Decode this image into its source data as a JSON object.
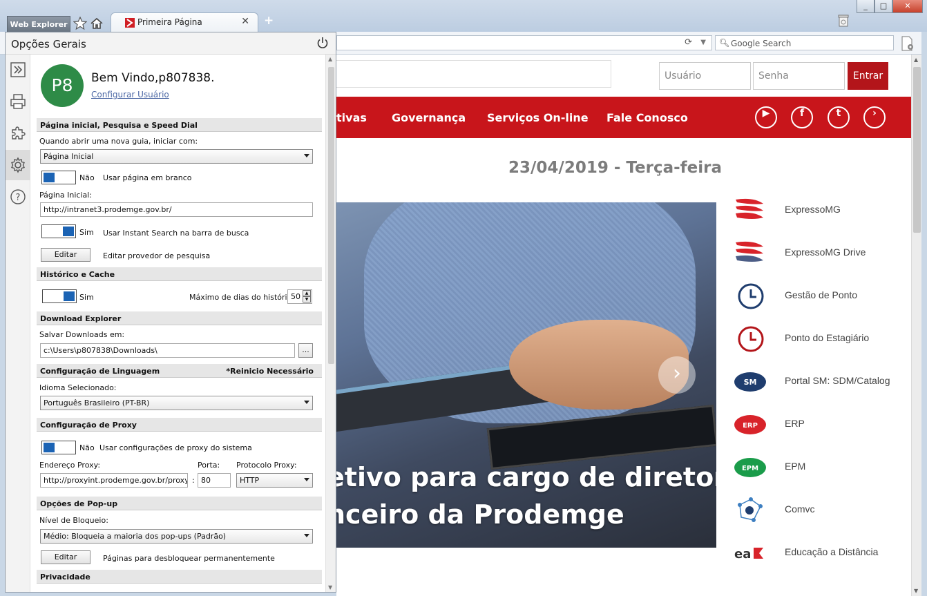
{
  "browser": {
    "app_label": "Web Explorer",
    "tab_title": "Primeira Página",
    "search_placeholder": "Google Search",
    "window_buttons": [
      "_",
      "□",
      "✕"
    ]
  },
  "panel": {
    "title": "Opções Gerais",
    "user": {
      "avatar_initials": "P8",
      "welcome": "Bem Vindo,p807838.",
      "configure_link": "Configurar Usuário"
    },
    "sections": {
      "start": {
        "header": "Página inicial, Pesquisa e Speed Dial",
        "new_tab_label": "Quando abrir uma nova guia, iniciar com:",
        "new_tab_value": "Página Inicial",
        "blank_toggle_state": "Não",
        "blank_toggle_label": "Usar página em branco",
        "home_label": "Página Inicial:",
        "home_value": "http://intranet3.prodemge.gov.br/",
        "instant_toggle_state": "Sim",
        "instant_toggle_label": "Usar Instant Search na barra de busca",
        "edit_button": "Editar",
        "edit_label": "Editar provedor de pesquisa"
      },
      "history": {
        "header": "Histórico e Cache",
        "toggle_state": "Sim",
        "max_days_label": "Máximo de dias do histórico:",
        "max_days_value": "50"
      },
      "download": {
        "header": "Download Explorer",
        "save_label": "Salvar Downloads em:",
        "save_value": "c:\\Users\\p807838\\Downloads\\",
        "browse_button": "..."
      },
      "language": {
        "header": "Configuração de Linguagem",
        "restart_note": "*Reinicio Necessário",
        "selected_label": "Idioma Selecionado:",
        "selected_value": "Português Brasileiro (PT-BR)"
      },
      "proxy": {
        "header": "Configuração de Proxy",
        "toggle_state": "Não",
        "toggle_label": "Usar configurações de proxy do sistema",
        "address_label": "Endereço Proxy:",
        "address_value": "http://proxyint.prodemge.gov.br/proxy.pac",
        "port_label": "Porta:",
        "port_value": "80",
        "protocol_label": "Protocolo Proxy:",
        "protocol_value": "HTTP"
      },
      "popup": {
        "header": "Opções de Pop-up",
        "level_label": "Nível de Bloqueio:",
        "level_value": "Médio: Bloqueia a maioria dos pop-ups (Padrão)",
        "edit_button": "Editar",
        "edit_label": "Páginas para desbloquear permanentemente"
      },
      "privacy": {
        "header": "Privacidade"
      }
    },
    "iconbar": [
      "expand-icon",
      "print-icon",
      "extensions-icon",
      "settings-icon",
      "help-icon"
    ]
  },
  "webpage": {
    "username_placeholder": "Usuário",
    "password_placeholder": "Senha",
    "login_button": "Entrar",
    "nav": [
      "tivas",
      "Governança",
      "Serviços On-line",
      "Fale Conosco"
    ],
    "social": [
      "youtube-icon",
      "facebook-icon",
      "twitter-icon",
      "prodemge-icon"
    ],
    "date": "23/04/2019 - Terça-feira",
    "hero_lines": [
      "etivo para cargo de diretor",
      "nceiro da Prodemge"
    ],
    "links": [
      "ExpressoMG",
      "ExpressoMG Drive",
      "Gestão de Ponto",
      "Ponto do Estagiário",
      "Portal SM: SDM/Catalog",
      "ERP",
      "EPM",
      "Comvc",
      "Educação a Distância"
    ],
    "colors": {
      "brand_red": "#c8151b",
      "login_red": "#b3151a"
    }
  }
}
